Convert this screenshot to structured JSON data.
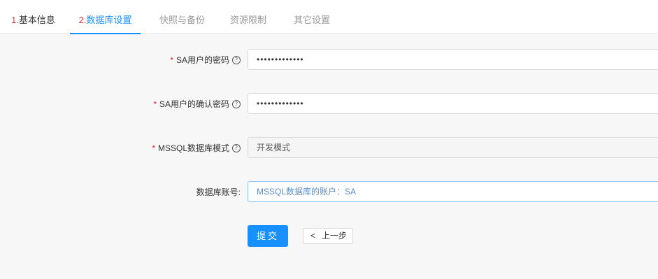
{
  "tabs": [
    {
      "num": "1.",
      "label": "基本信息"
    },
    {
      "num": "2.",
      "label": "数据库设置"
    },
    {
      "label": "快照与备份"
    },
    {
      "label": "资源限制"
    },
    {
      "label": "其它设置"
    }
  ],
  "form": {
    "sa_password": {
      "label": "SA用户的密码",
      "value": "•••••••••••••"
    },
    "sa_confirm": {
      "label": "SA用户的确认密码",
      "value": "•••••••••••••"
    },
    "mode": {
      "label": "MSSQL数据库模式",
      "value": "开发模式"
    },
    "account": {
      "label": "数据库账号:",
      "placeholder": "MSSQL数据库的账户：SA"
    },
    "required_mark": "*",
    "help_glyph": "?"
  },
  "actions": {
    "submit_label": "提交",
    "prev_chevron": "<",
    "prev_label": "上一步"
  },
  "colors": {
    "accent": "#1890ff",
    "required": "#f5222d",
    "step_number": "#e4393c"
  }
}
